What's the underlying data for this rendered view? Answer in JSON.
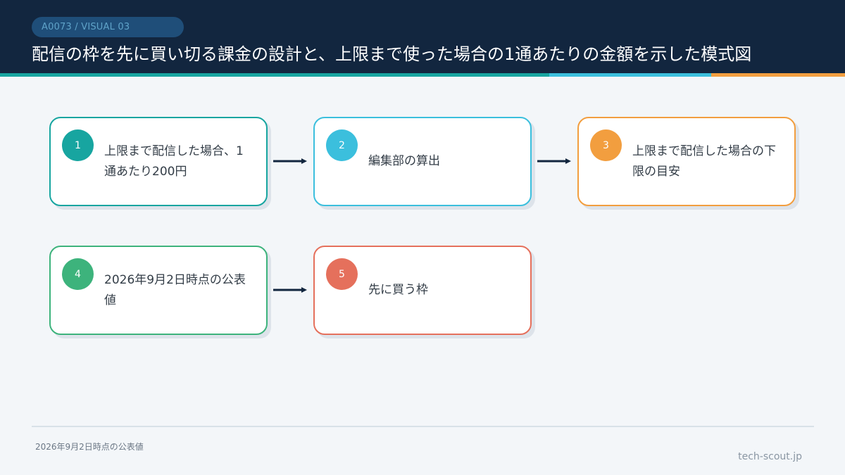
{
  "header": {
    "tag": "A0073 / VISUAL 03",
    "title": "配信の枠を先に買い切る課金の設計と、上限まで使った場合の1通あたりの金額を示した模式図"
  },
  "colors": {
    "header_bg": "#12263f",
    "teal": "#17a5a0",
    "sky": "#3bbfdd",
    "orange": "#f29e3f",
    "green": "#3db37c",
    "red": "#e5705c",
    "arrow": "#12263f"
  },
  "steps": [
    {
      "number": "1",
      "text": "上限まで配信した場合、1通あたり200円",
      "color": "teal"
    },
    {
      "number": "2",
      "text": "編集部の算出",
      "color": "sky"
    },
    {
      "number": "3",
      "text": "上限まで配信した場合の下限の目安",
      "color": "orange"
    },
    {
      "number": "4",
      "text": "2026年9月2日時点の公表値",
      "color": "green"
    },
    {
      "number": "5",
      "text": "先に買う枠",
      "color": "red"
    }
  ],
  "footer": {
    "note": "2026年9月2日時点の公表値",
    "site": "tech-scout.jp"
  }
}
